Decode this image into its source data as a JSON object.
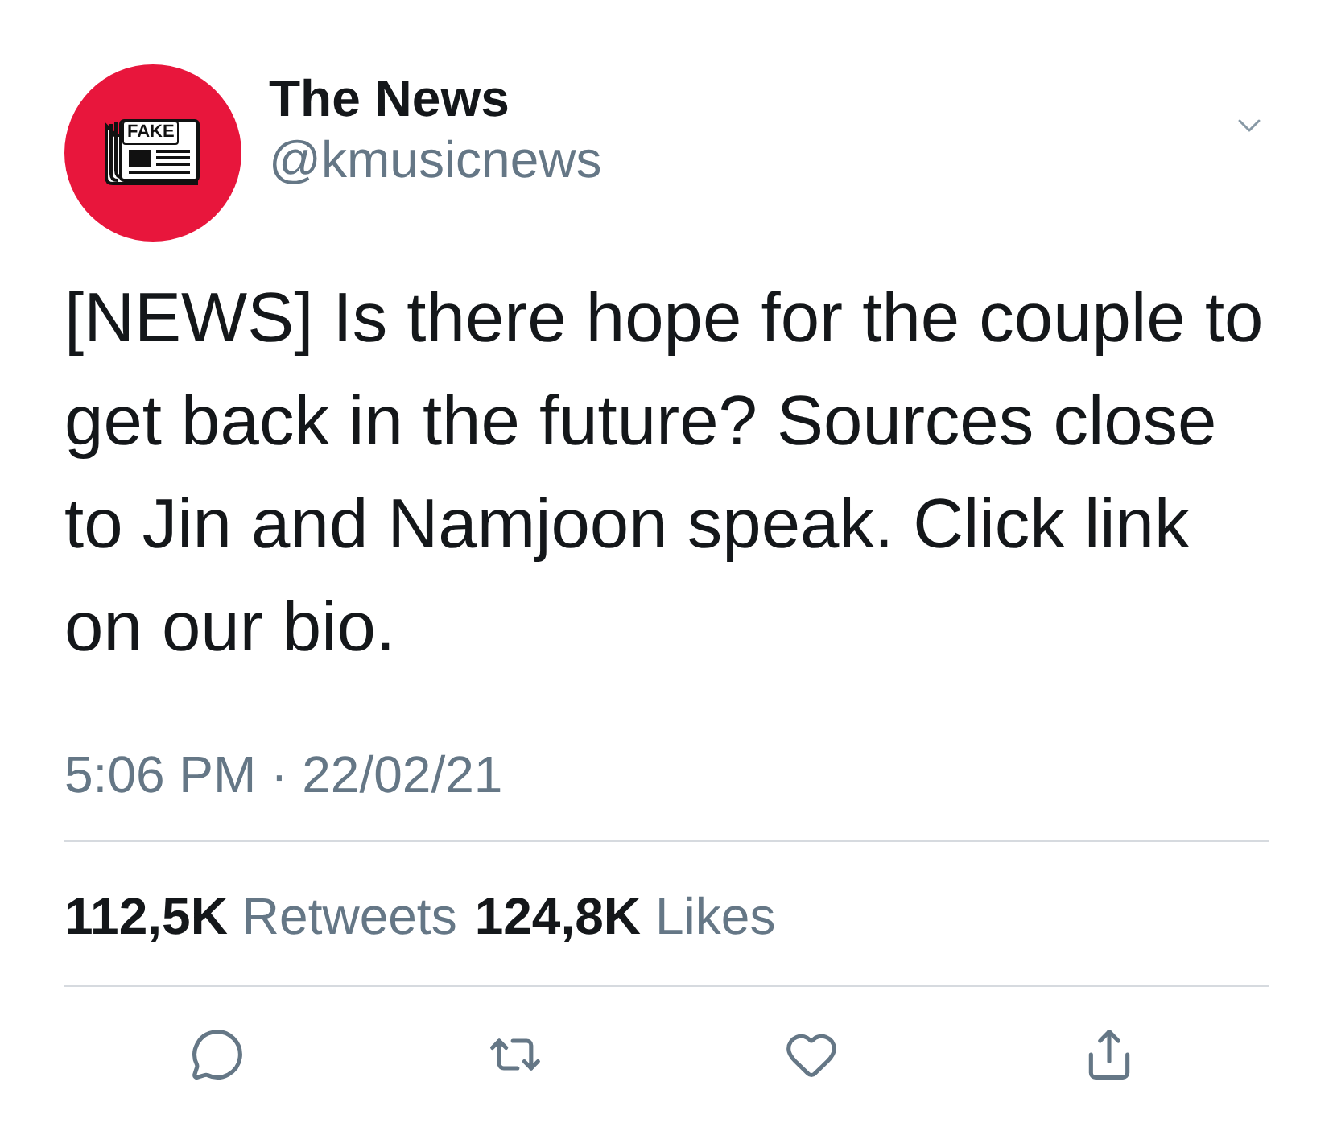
{
  "tweet": {
    "author": {
      "name": "The News",
      "handle": "@kmusicnews",
      "avatar_text": "FAKE"
    },
    "text": "[NEWS] Is there hope for the couple to get back in the future? Sources close to Jin and Namjoon speak. Click link on our bio.",
    "timestamp": "5:06 PM · 22/02/21",
    "stats": [
      {
        "count": "112,5K",
        "label": "Retweets"
      },
      {
        "count": "124,8K",
        "label": "Likes"
      }
    ],
    "actions": [
      {
        "kind": "reply"
      },
      {
        "kind": "retweet"
      },
      {
        "kind": "like"
      },
      {
        "kind": "share"
      }
    ]
  }
}
